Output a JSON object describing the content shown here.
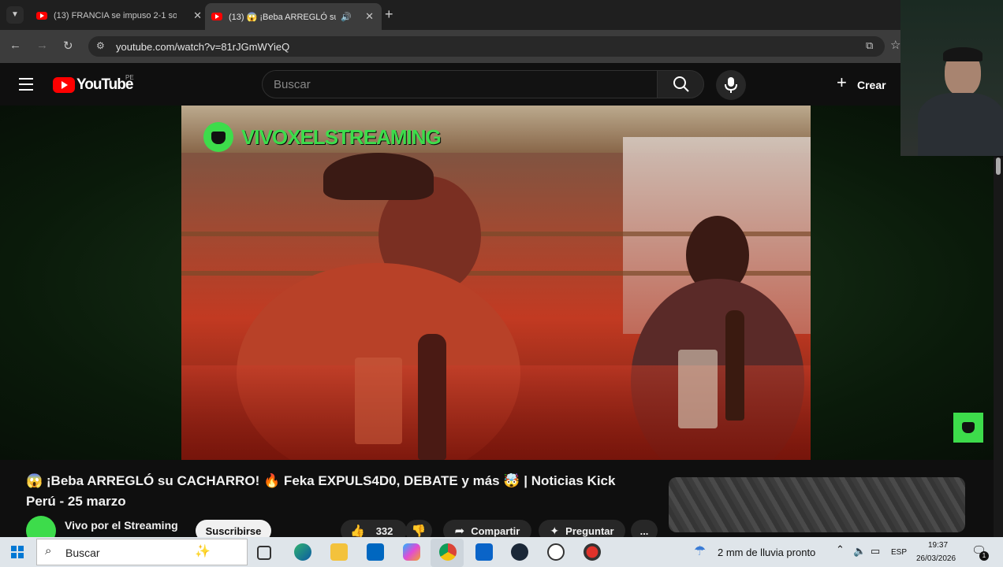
{
  "browser": {
    "tabs": [
      {
        "title": "(13) FRANCIA se impuso 2-1 so"
      },
      {
        "title": "(13) 😱 ¡Beba ARREGLÓ su"
      }
    ],
    "new_tab_glyph": "+",
    "url": "youtube.com/watch?v=81rJGmWYieQ"
  },
  "youtube": {
    "logo_text": "YouTube",
    "region": "PE",
    "search_placeholder": "Buscar",
    "create_label": "Crear"
  },
  "video": {
    "overlay_brand": "VIVOXELSTREAMING",
    "title_line1": "😱 ¡Beba ARREGLÓ su CACHARRO! 🔥 Feka EXPULS4D0, DEBATE y más 🤯 | Noticias Kick",
    "title_line2": "Perú - 25 marzo",
    "channel_name": "Vivo por el Streaming",
    "subscribe_label": "Suscribirse",
    "like_count": "332",
    "share_label": "Compartir",
    "ask_label": "Preguntar",
    "more_label": "..."
  },
  "taskbar": {
    "search_placeholder": "Buscar",
    "weather": "2 mm de lluvia pronto",
    "language": "ESP",
    "time": "19:37",
    "date": "26/03/2026",
    "notification_count": "1"
  },
  "colors": {
    "youtube_red": "#ff0000",
    "overlay_green": "#3ddc4b",
    "page_bg": "#0f0f0f"
  }
}
